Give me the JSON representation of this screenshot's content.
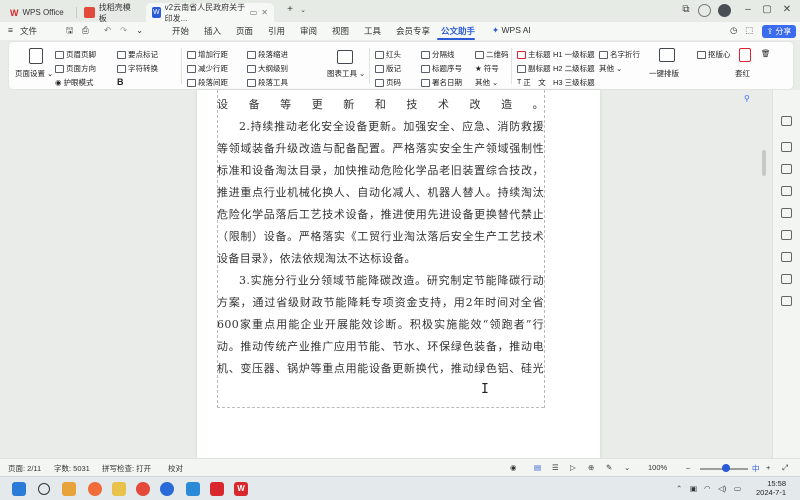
{
  "tabs": {
    "wps_office": "WPS Office",
    "templates": "找稻壳模板",
    "document": "v2云南省人民政府关于印发..."
  },
  "menus": [
    "开始",
    "插入",
    "页面",
    "引用",
    "审阅",
    "视图",
    "工具",
    "会员专享",
    "公文助手",
    "WPS AI"
  ],
  "share_label": "分享",
  "ribbon": {
    "page_setup": "页面设置",
    "header_footer": "页眉页脚",
    "page_orientation": "页面方向",
    "eye_mode": "护眼模式",
    "key_marks": "要点标记",
    "char_convert": "字符转换",
    "bold": "B",
    "add_indent": "增加行距",
    "reduce_indent": "减少行距",
    "para_indent": "段落间距",
    "para_spacing": "段落缩进",
    "outline_level": "大纲级别",
    "para_tools": "段落工具",
    "image_tools": "图表工具",
    "red_head": "红头",
    "copy_marks": "版记",
    "page_number": "页码",
    "separator_line": "分隔线",
    "title_number": "标题序号",
    "signature_date": "署名日期",
    "qr_code": "二维码",
    "symbol": "符号",
    "others": "其他",
    "main_title": "主标题",
    "sub_title": "副标题",
    "body_text": "正　文",
    "h1": "一级标题",
    "h2": "二级标题",
    "h3": "三级标题",
    "name_line": "名字折行",
    "others2": "其他",
    "one_key_format": "一键排版",
    "version_check": "抠版心",
    "red_seal": "套红"
  },
  "document_lines": [
    "设备等更新和技术改造。",
    "2.持续推动老化安全设备更新。加强安全、应急、消防救援",
    "等领域装备升级改造与配备配置。严格落实安全生产领域强制性",
    "标准和设备淘汰目录，加快推动危险化学品老旧装置综合技改，",
    "推进重点行业机械化换人、自动化减人、机器人替人。持续淘汰",
    "危险化学品落后工艺技术设备，推进使用先进设备更换替代禁止",
    "（限制）设备。严格落实《工贸行业淘汰落后安全生产工艺技术",
    "设备目录》，依法依规淘汰不达标设备。",
    "3.实施分行业分领域节能降碳改造。研究制定节能降碳行动",
    "方案，通过省级财政节能降耗专项资金支持，用2年时间对全省",
    "600家重点用能企业开展能效诊断。积极实施能效“领跑者”行",
    "动。推动传统产业推广应用节能、节水、环保绿色装备，推动电",
    "机、变压器、锅炉等重点用能设备更新换代，推动绿色铝、硅光"
  ],
  "status": {
    "page": "页面: 2/11",
    "word_count": "字数: 5031",
    "spell_check": "拼写检查: 打开",
    "proofread": "校对",
    "zoom": "100%",
    "ime": "中"
  },
  "clock": {
    "time": "15:58",
    "date": "2024-7-1"
  },
  "colors": {
    "accent": "#2a5ad8",
    "share_button": "#3b6cf0",
    "wps_red": "#d9272e"
  }
}
